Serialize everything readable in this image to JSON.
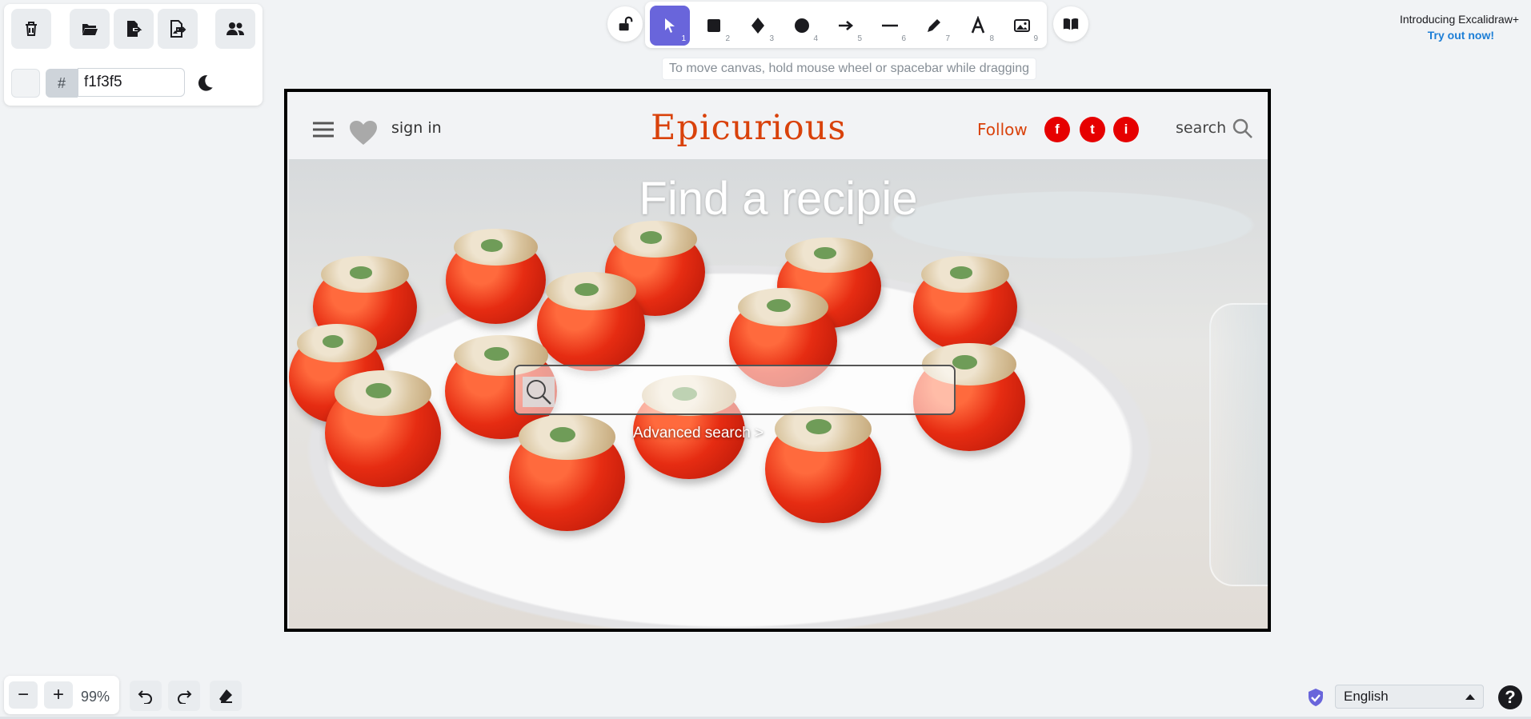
{
  "left_panel": {
    "clear_canvas_icon": "trash-icon",
    "open_icon": "folder-open-icon",
    "save_icon": "file-export-icon",
    "export_image_icon": "image-export-icon",
    "collaborate_icon": "users-icon",
    "background_label": "#",
    "background_value": "f1f3f5",
    "theme_icon": "moon-icon"
  },
  "toolbar": {
    "lock_icon": "lock-open-icon",
    "tools": [
      {
        "name": "selection",
        "num": "1",
        "active": true
      },
      {
        "name": "rectangle",
        "num": "2"
      },
      {
        "name": "diamond",
        "num": "3"
      },
      {
        "name": "ellipse",
        "num": "4"
      },
      {
        "name": "arrow",
        "num": "5"
      },
      {
        "name": "line",
        "num": "6"
      },
      {
        "name": "draw",
        "num": "7"
      },
      {
        "name": "text",
        "num": "8"
      },
      {
        "name": "image",
        "num": "9"
      }
    ],
    "library_icon": "book-icon",
    "hint": "To move canvas, hold mouse wheel or spacebar while dragging"
  },
  "promo": {
    "title": "Introducing Excalidraw+",
    "link": "Try out now!"
  },
  "mockup": {
    "sign_in": "sign in",
    "logo": "Epicurious",
    "follow": "Follow",
    "social": [
      "f",
      "t",
      "i"
    ],
    "search_label": "search",
    "hero_title": "Find a recipie",
    "advanced_search": "Advanced search >"
  },
  "footer": {
    "zoom_out": "−",
    "zoom_in": "+",
    "zoom_level": "99%",
    "language": "English",
    "help": "?"
  },
  "colors": {
    "canvas_bg": "#f1f3f5",
    "accent": "#6965db",
    "brand": "#d9420b",
    "social_red": "#e60000"
  }
}
